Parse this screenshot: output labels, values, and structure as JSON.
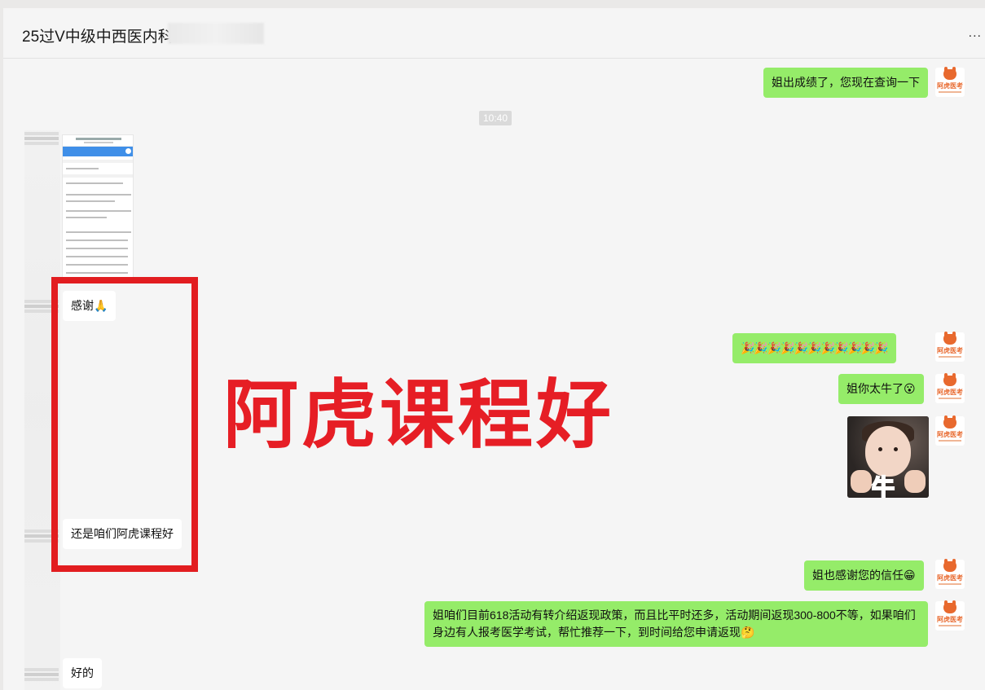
{
  "header": {
    "title": "25过V中级中西医内科",
    "more_label": "..."
  },
  "time_divider": "10:40",
  "avatars": {
    "me_brand": "阿虎医考"
  },
  "messages": [
    {
      "from": "me",
      "text": "姐出成绩了，您现在查询一下"
    },
    {
      "from": "them",
      "text": "感谢🙏"
    },
    {
      "from": "me",
      "text": "🎉🎉🎉🎉🎉🎉🎉🎉🎉🎉🎉"
    },
    {
      "from": "me",
      "text": "姐你太牛了😮"
    },
    {
      "from": "them",
      "text": "还是咱们阿虎课程好"
    },
    {
      "from": "me",
      "text": "姐也感谢您的信任😁"
    },
    {
      "from": "me",
      "text": "姐咱们目前618活动有转介绍返现政策，而且比平时还多，活动期间返现300-800不等，如果咱们身边有人报考医学考试，帮忙推荐一下，到时间给您申请返现🤔"
    },
    {
      "from": "them",
      "text": "好的"
    }
  ],
  "image_message": {
    "sticker_text": "牛"
  },
  "overlay": {
    "caption": "阿虎课程好"
  }
}
